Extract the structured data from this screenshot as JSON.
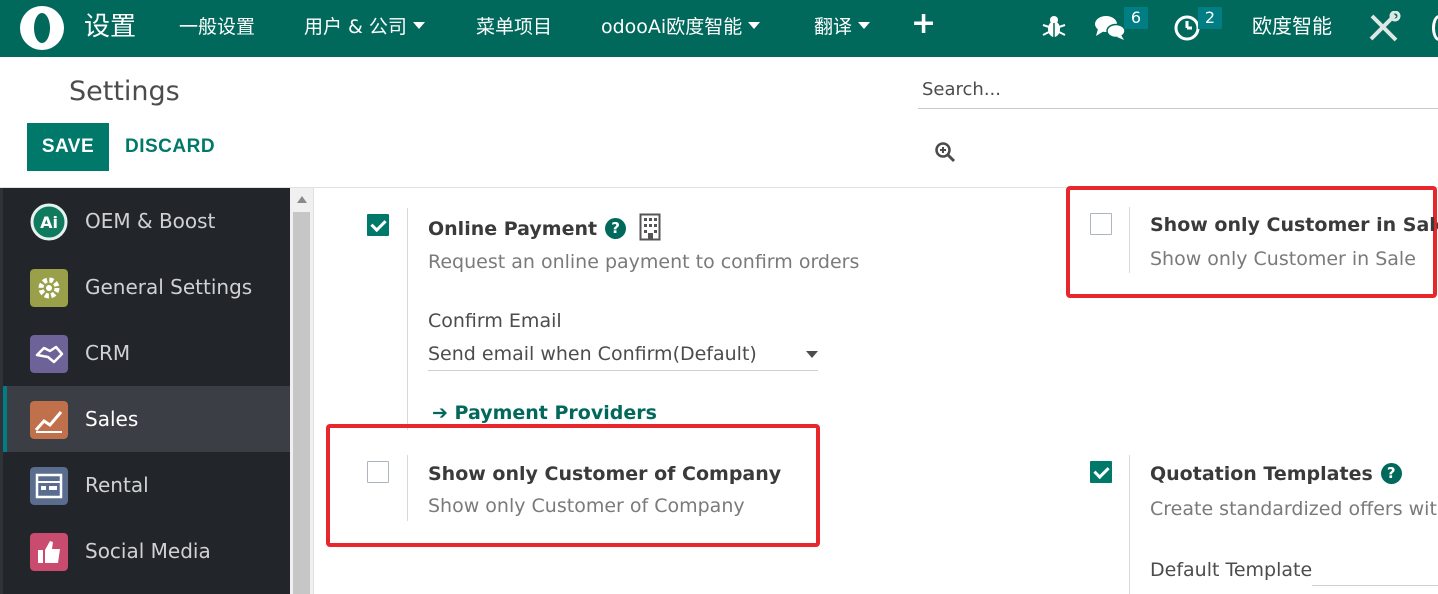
{
  "navbar": {
    "app_title": "设置",
    "menu": [
      {
        "label": "一般设置",
        "dropdown": false
      },
      {
        "label": "用户 & 公司",
        "dropdown": true
      },
      {
        "label": "菜单项目",
        "dropdown": false
      },
      {
        "label": "odooAi欧度智能",
        "dropdown": true
      },
      {
        "label": "翻译",
        "dropdown": true
      }
    ],
    "messages_count": "6",
    "activities_count": "2",
    "company": "欧度智能",
    "colors": {
      "bar": "#00695c",
      "badge": "#017e84"
    }
  },
  "control_panel": {
    "breadcrumb": "Settings",
    "save_label": "SAVE",
    "discard_label": "DISCARD",
    "search_placeholder": "Search..."
  },
  "sidebar": {
    "items": [
      {
        "label": "OEM & Boost",
        "icon": "ai-icon",
        "active": false
      },
      {
        "label": "General Settings",
        "icon": "gear-icon",
        "active": false
      },
      {
        "label": "CRM",
        "icon": "handshake-icon",
        "active": false
      },
      {
        "label": "Sales",
        "icon": "chart-icon",
        "active": true
      },
      {
        "label": "Rental",
        "icon": "rental-icon",
        "active": false
      },
      {
        "label": "Social Media",
        "icon": "thumbs-up-icon",
        "active": false
      }
    ]
  },
  "settings": {
    "online_payment": {
      "checked": true,
      "title": "Online Payment",
      "desc": "Request an online payment to confirm orders",
      "confirm_email_label": "Confirm Email",
      "confirm_email_value": "Send email when Confirm(Default)",
      "link": "Payment Providers"
    },
    "show_customer_sale": {
      "checked": false,
      "title": "Show only Customer in Sale",
      "desc": "Show only Customer in Sale"
    },
    "show_customer_company": {
      "checked": false,
      "title": "Show only Customer of Company",
      "desc": "Show only Customer of Company"
    },
    "quotation_templates": {
      "checked": true,
      "title": "Quotation Templates",
      "desc": "Create standardized offers with",
      "default_template_label": "Default Template"
    }
  },
  "accent_color": "#00796b",
  "highlight_color": "#e8272c"
}
